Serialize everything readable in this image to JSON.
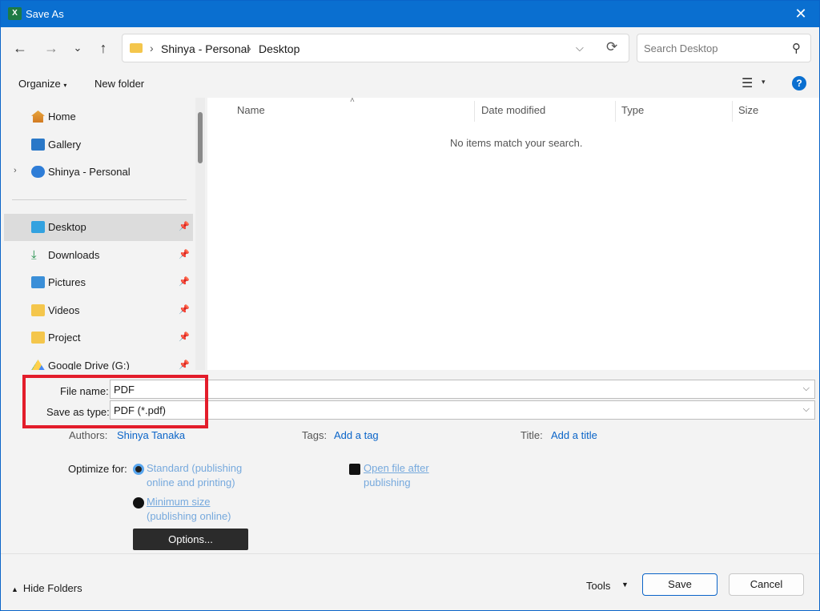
{
  "window": {
    "title": "Save As",
    "app_icon": "excel-icon",
    "close_icon": "close-icon"
  },
  "address_bar": {
    "breadcrumbs": [
      "Shinya - Personal",
      "Desktop"
    ],
    "search_placeholder": "Search Desktop"
  },
  "command_bar": {
    "organize_label": "Organize",
    "new_folder_label": "New folder",
    "help_label": "?"
  },
  "nav_pane": {
    "items": [
      {
        "label": "Home",
        "icon": "home-icon"
      },
      {
        "label": "Gallery",
        "icon": "gallery-icon"
      },
      {
        "label": "Shinya - Personal",
        "icon": "onedrive-icon"
      },
      {
        "label": "Desktop",
        "icon": "desktop-icon",
        "selected": true,
        "pinned": true
      },
      {
        "label": "Downloads",
        "icon": "download-icon",
        "pinned": true
      },
      {
        "label": "Pictures",
        "icon": "pictures-icon",
        "pinned": true
      },
      {
        "label": "Videos",
        "icon": "folder-icon",
        "pinned": true
      },
      {
        "label": "Project",
        "icon": "folder-icon",
        "pinned": true
      },
      {
        "label": "Google Drive (G:)",
        "icon": "google-drive-icon",
        "pinned": true
      }
    ]
  },
  "file_list": {
    "columns": [
      "Name",
      "Date modified",
      "Type",
      "Size"
    ],
    "empty_message": "No items match your search."
  },
  "form": {
    "file_name_label": "File name:",
    "file_name_value": "PDF",
    "save_type_label": "Save as type:",
    "save_type_value": "PDF (*.pdf)",
    "authors_label": "Authors:",
    "authors_value": "Shinya Tanaka",
    "tags_label": "Tags:",
    "tags_value": "Add a tag",
    "title_label": "Title:",
    "title_value": "Add a title",
    "optimize_label": "Optimize for:",
    "optimize_standard_line1": "Standard (publishing",
    "optimize_standard_line2": "online and printing)",
    "optimize_minimum_line1": "Minimum size",
    "optimize_minimum_line2": "(publishing online)",
    "open_after_line1": "Open file after",
    "open_after_line2": "publishing",
    "options_label": "Options..."
  },
  "footer": {
    "hide_folders_label": "Hide Folders",
    "tools_label": "Tools",
    "save_label": "Save",
    "cancel_label": "Cancel"
  },
  "colors": {
    "title_bar": "#0a6fd0",
    "highlight_box": "#e31d2b",
    "link": "#0a64c8"
  }
}
